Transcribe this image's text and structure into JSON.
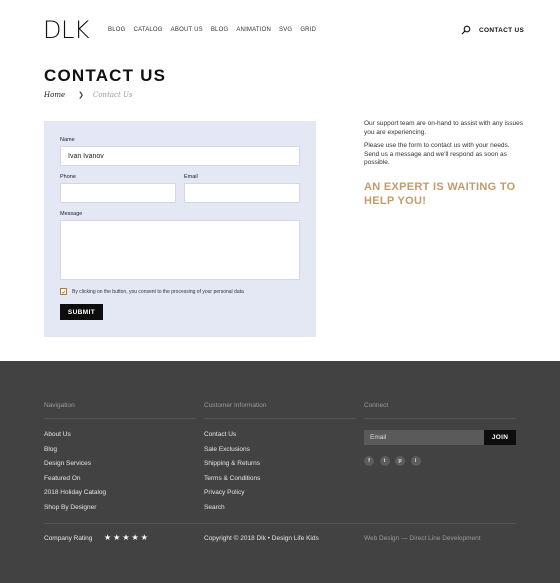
{
  "header": {
    "logo": "DLK",
    "nav": [
      "BLOG",
      "CATALOG",
      "ABOUT US",
      "BLOG",
      "ANIMATION",
      "SVG",
      "GRID"
    ],
    "contact_link": "CONTACT US",
    "search_icon": "search-icon"
  },
  "page": {
    "title": "CONTACT  US",
    "breadcrumb": {
      "home": "Home",
      "current": "Contact Us"
    }
  },
  "form": {
    "name_label": "Name",
    "name_value": "Ivan Ivanov",
    "phone_label": "Phone",
    "phone_value": "",
    "email_label": "Email",
    "email_value": "",
    "message_label": "Message",
    "message_value": "",
    "consent_text": "By clicking on the button, you consent to the processing of your personal data",
    "consent_checked": true,
    "submit_label": "SUBMIT"
  },
  "side": {
    "support_text": "Our support team are on-hand to assist with any issues you are experiencing.",
    "form_text": "Please use the form to contact us with your needs. Send us a message and we'll respond as soon as possible.",
    "expert_heading": "AN EXPERT IS WAITING TO HELP YOU!"
  },
  "footer": {
    "navigation": {
      "heading": "Navigation",
      "links": [
        "About Us",
        "Blog",
        "Design Services",
        "Featured On",
        "2018 Holiday Catalog",
        "Shop By Designer"
      ]
    },
    "customer": {
      "heading": "Customer Information",
      "links": [
        "Contact Us",
        "Sale Exclusions",
        "Shipping & Returns",
        "Terms & Conditions",
        "Privacy Policy",
        "Search"
      ]
    },
    "connect": {
      "heading": "Connect",
      "email_placeholder": "Email",
      "join_label": "JOIN",
      "socials": [
        "f",
        "t",
        "p",
        "i"
      ]
    },
    "rating_label": "Company Rating",
    "stars": 5,
    "copyright": "Copyright © 2018 Dlk • Design Life Kids",
    "credit": "Web Design — Direct Line Development"
  },
  "colors": {
    "accent": "#c49b6c",
    "form_bg": "#e4e8f5",
    "footer_bg": "#424242"
  }
}
